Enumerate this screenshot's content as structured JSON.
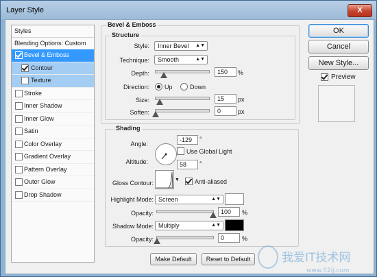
{
  "window": {
    "title": "Layer Style",
    "close_label": "X"
  },
  "styles_list": {
    "header": "Styles",
    "blending_options": "Blending Options: Custom",
    "items": [
      {
        "label": "Bevel & Emboss",
        "checked": true,
        "selected": true
      },
      {
        "label": "Contour",
        "checked": true,
        "sub": true
      },
      {
        "label": "Texture",
        "checked": false,
        "sub": true
      },
      {
        "label": "Stroke",
        "checked": false
      },
      {
        "label": "Inner Shadow",
        "checked": false
      },
      {
        "label": "Inner Glow",
        "checked": false
      },
      {
        "label": "Satin",
        "checked": false
      },
      {
        "label": "Color Overlay",
        "checked": false
      },
      {
        "label": "Gradient Overlay",
        "checked": false
      },
      {
        "label": "Pattern Overlay",
        "checked": false
      },
      {
        "label": "Outer Glow",
        "checked": false
      },
      {
        "label": "Drop Shadow",
        "checked": false
      }
    ]
  },
  "bevel": {
    "group_title": "Bevel & Emboss",
    "structure_title": "Structure",
    "style_label": "Style:",
    "style_value": "Inner Bevel",
    "technique_label": "Technique:",
    "technique_value": "Smooth",
    "depth_label": "Depth:",
    "depth_value": "150",
    "depth_unit": "%",
    "depth_level": 0.15,
    "direction_label": "Direction:",
    "dir_up": "Up",
    "dir_down": "Down",
    "size_label": "Size:",
    "size_value": "15",
    "size_unit": "px",
    "size_level": 0.08,
    "soften_label": "Soften:",
    "soften_value": "0",
    "soften_unit": "px",
    "soften_level": 0
  },
  "shading": {
    "title": "Shading",
    "angle_label": "Angle:",
    "angle_value": "-129",
    "angle_unit": "°",
    "global_light_label": "Use Global Light",
    "altitude_label": "Altitude:",
    "altitude_value": "58",
    "altitude_unit": "°",
    "gloss_label": "Gloss Contour:",
    "antialiased_label": "Anti-aliased",
    "highlight_mode_label": "Highlight Mode:",
    "highlight_mode_value": "Screen",
    "highlight_color": "#ffffff",
    "opacity_label": "Opacity:",
    "highlight_opacity": "100",
    "highlight_opacity_level": 1.0,
    "shadow_mode_label": "Shadow Mode:",
    "shadow_mode_value": "Multiply",
    "shadow_color": "#000000",
    "shadow_opacity_label": "Opacity:",
    "shadow_opacity": "0",
    "shadow_opacity_level": 0,
    "percent": "%"
  },
  "buttons": {
    "make_default": "Make Default",
    "reset_default": "Reset to Default",
    "ok": "OK",
    "cancel": "Cancel",
    "new_style": "New Style...",
    "preview": "Preview"
  },
  "watermark": {
    "text": "我爱IT技术网",
    "url": "www.52ij.com"
  }
}
